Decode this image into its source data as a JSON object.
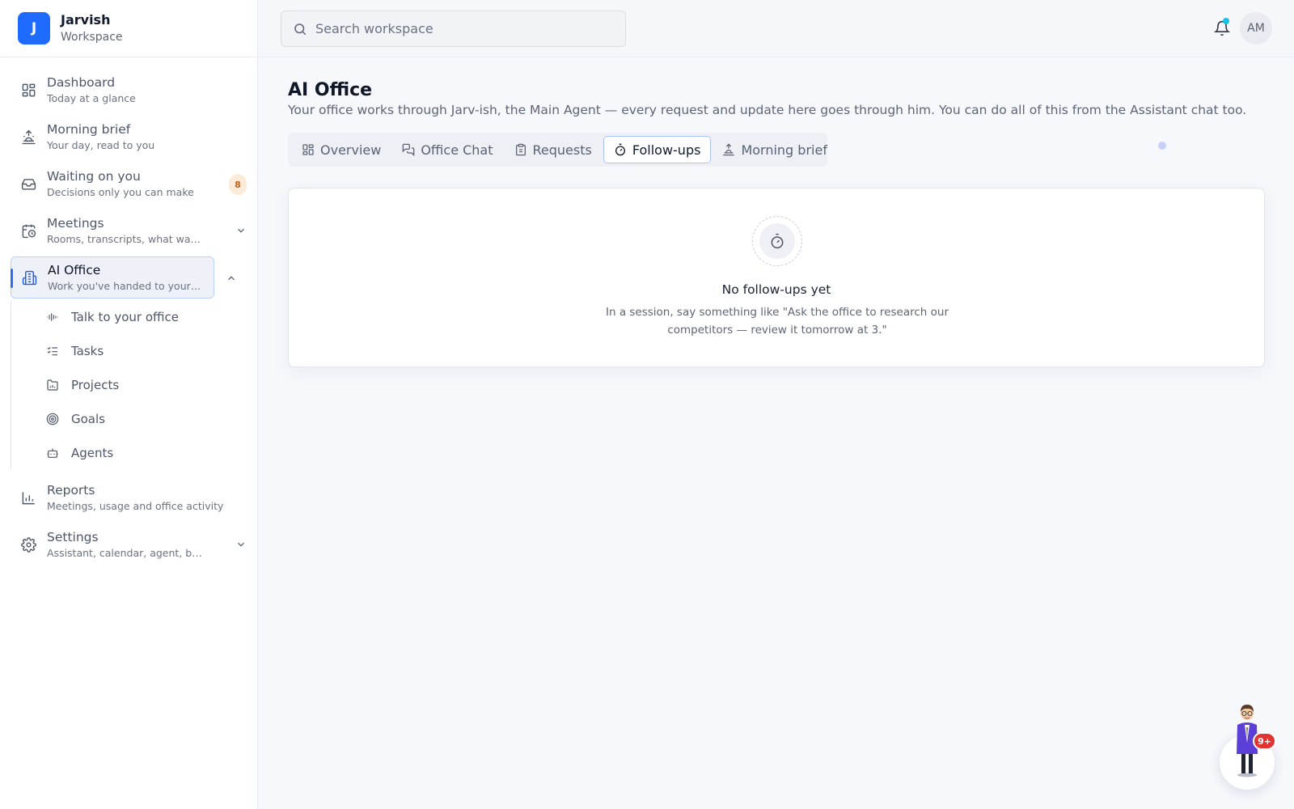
{
  "brand": {
    "initial": "J",
    "name": "Jarvish",
    "subtitle": "Workspace"
  },
  "search": {
    "placeholder": "Search workspace",
    "icon": "search-icon"
  },
  "header": {
    "avatar_initials": "AM",
    "notification_icon": "bell-icon"
  },
  "sidebar": {
    "items": [
      {
        "title": "Dashboard",
        "subtitle": "Today at a glance",
        "icon": "grid-icon"
      },
      {
        "title": "Morning brief",
        "subtitle": "Your day, read to you",
        "icon": "sunrise-icon"
      },
      {
        "title": "Waiting on you",
        "subtitle": "Decisions only you can make",
        "icon": "inbox-icon",
        "badge": "8"
      },
      {
        "title": "Meetings",
        "subtitle": "Rooms, transcripts, what was...",
        "icon": "calendar-clock-icon"
      },
      {
        "title": "AI Office",
        "subtitle": "Work you've handed to your ...",
        "icon": "building-icon",
        "active": true
      },
      {
        "title": "Reports",
        "subtitle": "Meetings, usage and office activity",
        "icon": "bar-chart-icon"
      },
      {
        "title": "Settings",
        "subtitle": "Assistant, calendar, agent, bil...",
        "icon": "gear-icon"
      }
    ],
    "subitems": [
      {
        "label": "Talk to your office",
        "icon": "audio-wave-icon"
      },
      {
        "label": "Tasks",
        "icon": "checklist-icon"
      },
      {
        "label": "Projects",
        "icon": "folder-icon"
      },
      {
        "label": "Goals",
        "icon": "target-icon"
      },
      {
        "label": "Agents",
        "icon": "bot-icon"
      }
    ]
  },
  "page": {
    "title": "AI Office",
    "description": "Your office works through Jarv-ish, the Main Agent — every request and update here goes through him. You can do all of this from the Assistant chat too."
  },
  "tabs": [
    {
      "label": "Overview",
      "icon": "grid-icon"
    },
    {
      "label": "Office Chat",
      "icon": "chat-icon"
    },
    {
      "label": "Requests",
      "icon": "clipboard-icon"
    },
    {
      "label": "Follow-ups",
      "icon": "stopwatch-icon",
      "active": true
    },
    {
      "label": "Morning brief",
      "icon": "sunrise-icon"
    }
  ],
  "empty_state": {
    "icon": "stopwatch-icon",
    "title": "No follow-ups yet",
    "text": "In a session, say something like \"Ask the office to research our competitors — review it tomorrow at 3.\""
  },
  "assistant": {
    "badge": "9+",
    "icon": "assistant-character-icon"
  },
  "colors": {
    "accent": "#1f6bff",
    "badge_bg": "#fdebd9",
    "notification_dot": "#14c2e3",
    "fab_badge": "#e33232"
  }
}
